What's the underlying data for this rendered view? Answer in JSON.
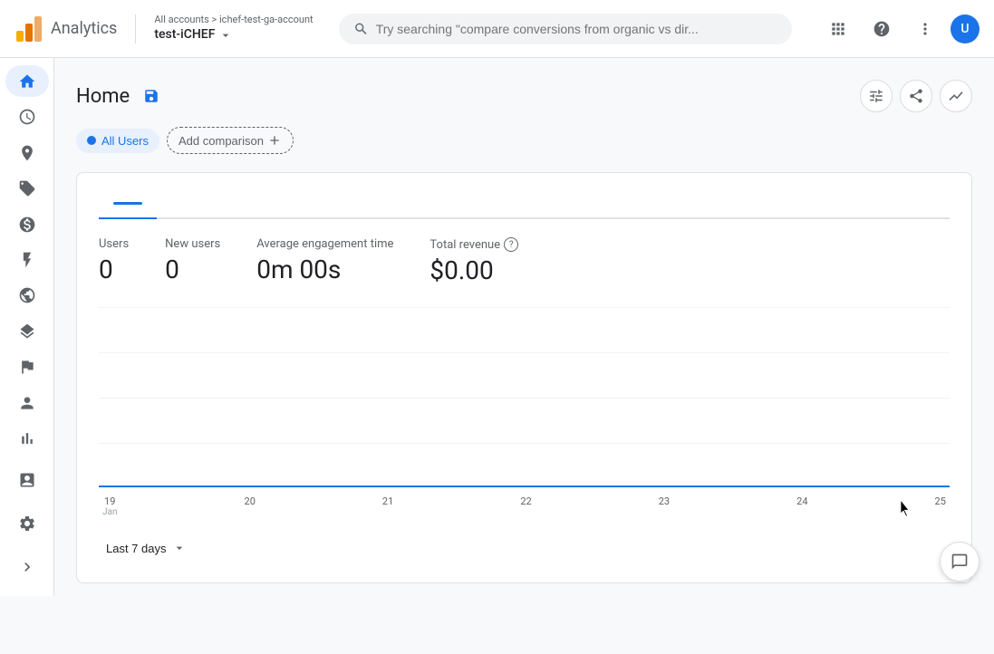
{
  "header": {
    "app_name": "Analytics",
    "breadcrumb": "All accounts > ichef-test-ga-account",
    "account_all": "All accounts",
    "account_sub": "ichef-test-ga-account",
    "account_name": "test-iCHEF",
    "search_placeholder": "Try searching \"compare conversions from organic vs dir...",
    "user_initial": "U"
  },
  "sidebar": {
    "items": [
      {
        "name": "home",
        "label": "Home",
        "active": true
      },
      {
        "name": "reports",
        "label": "Reports",
        "active": false
      },
      {
        "name": "explore",
        "label": "Explore",
        "active": false
      },
      {
        "name": "advertising",
        "label": "Advertising",
        "active": false
      },
      {
        "name": "configure",
        "label": "Configure",
        "active": false
      },
      {
        "name": "audience",
        "label": "Audience",
        "active": false
      },
      {
        "name": "flags",
        "label": "Flags",
        "active": false
      },
      {
        "name": "attribution",
        "label": "Attribution",
        "active": false
      },
      {
        "name": "expand-more",
        "label": "Expand",
        "active": false
      }
    ],
    "bottom_items": [
      {
        "name": "admin",
        "label": "Admin"
      }
    ]
  },
  "page": {
    "title": "Home",
    "comparison_segment": "All Users",
    "add_comparison": "Add comparison",
    "tabs": [
      {
        "label": "Line chart",
        "active": true
      }
    ],
    "metrics": [
      {
        "label": "Users",
        "value": "0",
        "has_help": false
      },
      {
        "label": "New users",
        "value": "0",
        "has_help": false
      },
      {
        "label": "Average engagement time",
        "value": "0m 00s",
        "has_help": false
      },
      {
        "label": "Total revenue",
        "value": "$0.00",
        "has_help": true
      }
    ],
    "x_axis_labels": [
      {
        "date": "19",
        "month": "Jan"
      },
      {
        "date": "20",
        "month": ""
      },
      {
        "date": "21",
        "month": ""
      },
      {
        "date": "22",
        "month": ""
      },
      {
        "date": "23",
        "month": ""
      },
      {
        "date": "24",
        "month": ""
      },
      {
        "date": "25",
        "month": ""
      }
    ],
    "date_range": "Last 7 days"
  },
  "actions": {
    "save_label": "Save",
    "customize_label": "Customize report",
    "share_label": "Share",
    "compare_label": "Compare dates"
  }
}
